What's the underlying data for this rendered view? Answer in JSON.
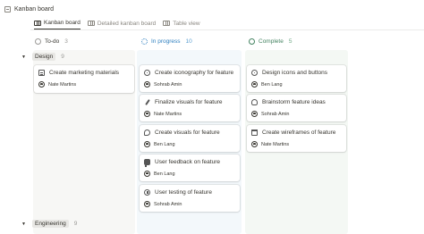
{
  "window": {
    "title": "Kanban board"
  },
  "tabs": [
    {
      "label": "Kanban board",
      "active": true
    },
    {
      "label": "Detailed kanban board",
      "active": false
    },
    {
      "label": "Table view",
      "active": false
    }
  ],
  "columns": [
    {
      "label": "To-do",
      "count": "3",
      "color": "#9b9a97"
    },
    {
      "label": "In progress",
      "count": "10",
      "color": "#2e7fbf"
    },
    {
      "label": "Complete",
      "count": "5",
      "color": "#448361"
    }
  ],
  "groups": [
    {
      "label": "Design",
      "count": "9"
    },
    {
      "label": "Engineering",
      "count": "9"
    }
  ],
  "cards": {
    "todo": [
      {
        "title": "Create marketing materials",
        "person": "Nate Martins",
        "icon": "document-icon"
      }
    ],
    "in_progress": [
      {
        "title": "Create iconography for feature",
        "person": "Sohrab Amin",
        "icon": "gear-icon"
      },
      {
        "title": "Finalize visuals for feature",
        "person": "Nate Martins",
        "icon": "pen-icon"
      },
      {
        "title": "Create visuals for feature",
        "person": "Ben Lang",
        "icon": "palette-icon"
      },
      {
        "title": "User feedback on feature",
        "person": "Ben Lang",
        "icon": "speech-bubble-icon"
      },
      {
        "title": "User testing of feature",
        "person": "Sohrab Amin",
        "icon": "test-icon"
      }
    ],
    "complete": [
      {
        "title": "Design icons and buttons",
        "person": "Ben Lang",
        "icon": "gear-icon"
      },
      {
        "title": "Brainstorm feature ideas",
        "person": "Sohrab Amin",
        "icon": "lightbulb-icon"
      },
      {
        "title": "Create wireframes of feature",
        "person": "Nate Martins",
        "icon": "trash-icon"
      }
    ]
  }
}
